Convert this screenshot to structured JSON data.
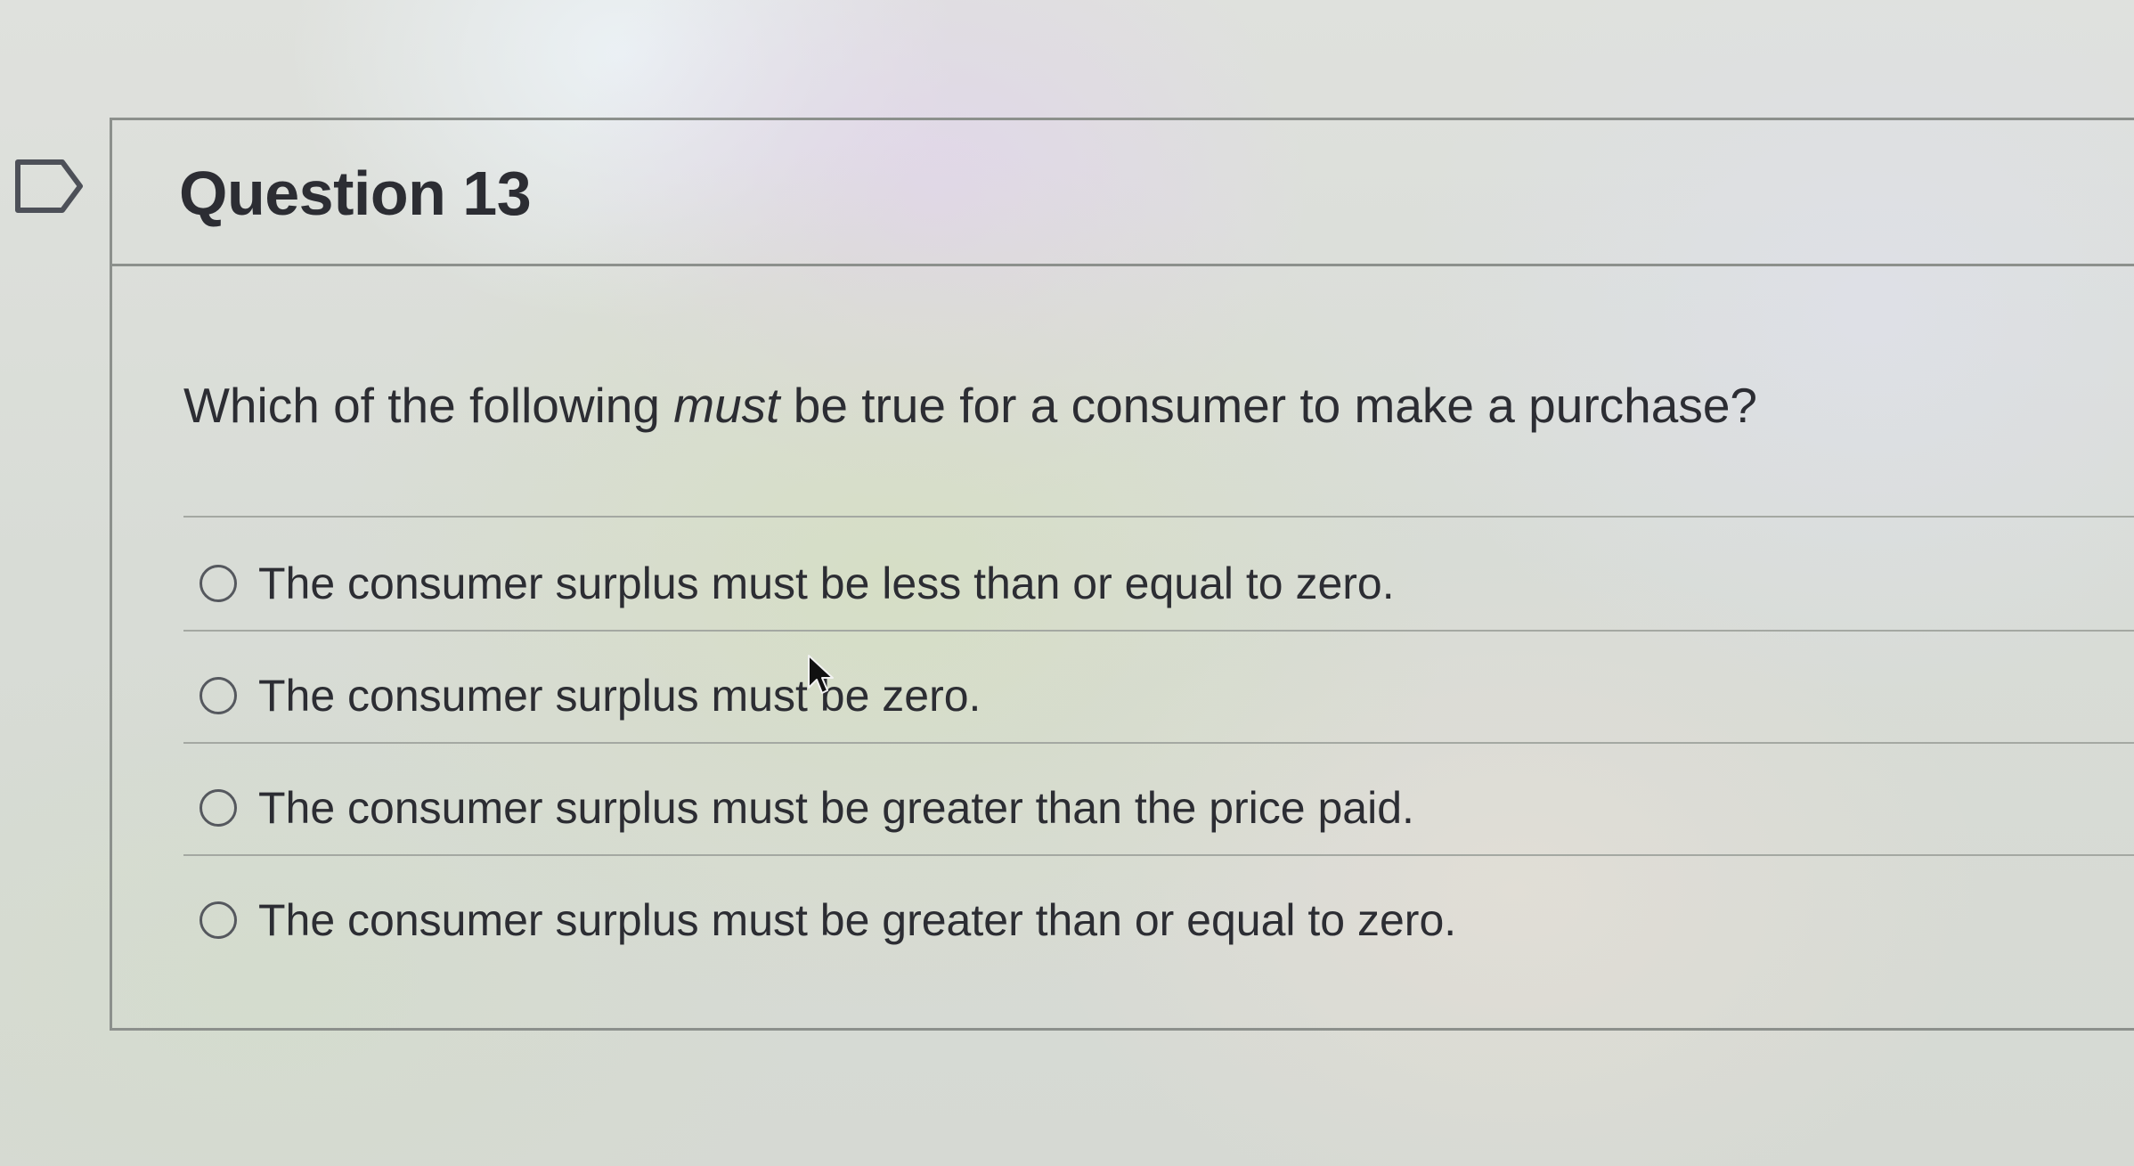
{
  "question": {
    "title": "Question 13",
    "prompt_before": "Which of the following ",
    "prompt_emphasis": "must",
    "prompt_after": " be true for a consumer to make a purchase?",
    "answers": [
      {
        "label": "The consumer surplus must be less than or equal to zero.",
        "selected": false
      },
      {
        "label": "The consumer surplus must be zero.",
        "selected": false
      },
      {
        "label": "The consumer surplus must be greater than the price paid.",
        "selected": false
      },
      {
        "label": "The consumer surplus must be greater than or equal to zero.",
        "selected": false
      }
    ]
  },
  "icons": {
    "flag": "flag-icon",
    "radio": "radio-button-icon",
    "cursor": "mouse-pointer-icon"
  },
  "colors": {
    "text": "#2c2d33",
    "border": "#8c908c",
    "divider": "#a4a8a2",
    "radio_border": "#55585e"
  }
}
